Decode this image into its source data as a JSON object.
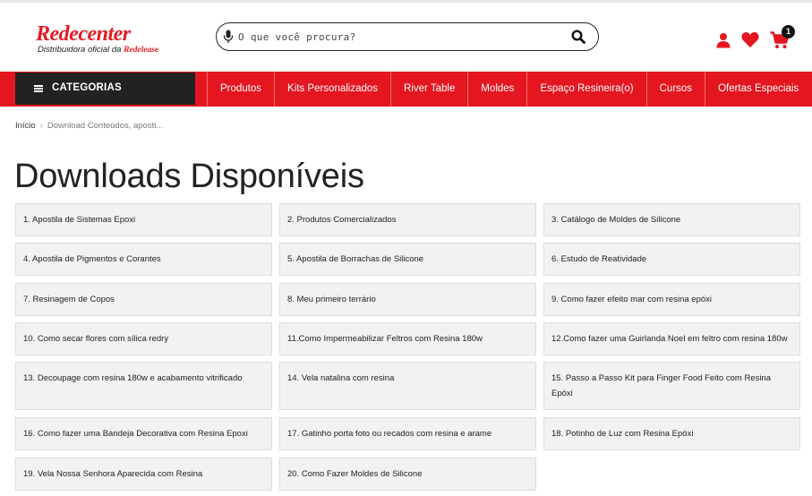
{
  "header": {
    "logo_main": "Redecenter",
    "logo_sub_prefix": "Distribuidora oficial da",
    "logo_sub_brand": "Redelease",
    "search_placeholder": "O que você procura?",
    "cart_count": "1"
  },
  "nav": {
    "categories_label": "CATEGORIAS",
    "items": [
      "Produtos",
      "Kits Personalizados",
      "River Table",
      "Moldes",
      "Espaço Resineira(o)",
      "Cursos",
      "Ofertas Especiais"
    ]
  },
  "breadcrumb": {
    "home": "Início",
    "current": "Download Conteúdos, aposti..."
  },
  "page_title": "Downloads Disponíveis",
  "downloads": [
    "1. Apostila de Sistemas Epoxi",
    "2. Produtos Comercializados",
    "3. Catálogo de Moldes de Silicone",
    "4. Apostila de Pigmentos e Corantes",
    "5. Apostila de Borrachas de Silicone",
    "6. Estudo de Reatividade",
    "7. Resinagem de Copos",
    "8. Meu primeiro terrário",
    "9. Como fazer efeito mar com resina epóxi",
    "10. Como secar flores com sílica redry",
    "11.Como Impermeabilizar Feltros com Resina 180w",
    "12.Como fazer uma Guirlanda Noel em feltro com resina 180w",
    "13. Decoupage com resina 180w e acabamento vitrificado",
    "14. Vela natalina com resina",
    "15. Passo a Passo Kit para Finger Food Feito com Resina Epóxi",
    "16. Como fazer uma Bandeja Decorativa com Resina Epoxi",
    "17. Gatinho porta foto ou recados com resina e arame",
    "18. Potinho de Luz com Resina Epóxi",
    "19. Vela Nossa Senhora Aparecida com Resina",
    "20. Como Fazer Moldes de Silicone"
  ],
  "colors": {
    "brand_red": "#e4161f",
    "dark": "#222222"
  }
}
